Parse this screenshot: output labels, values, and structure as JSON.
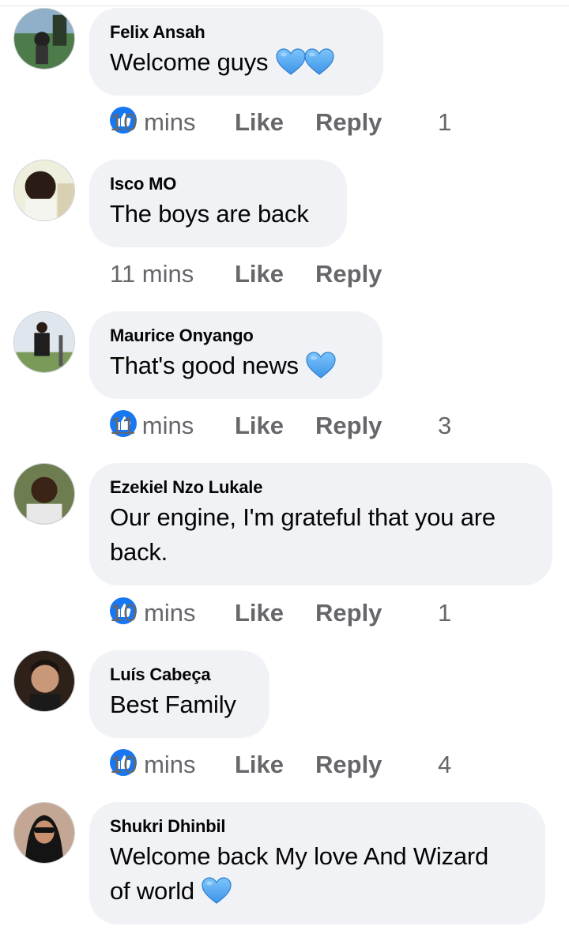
{
  "comments": [
    {
      "author": "Felix Ansah",
      "text": "Welcome guys",
      "hearts": 2,
      "time": "10 mins",
      "like": "Like",
      "reply": "Reply",
      "reactions": "1",
      "avatar_bg": "#3c6b3a"
    },
    {
      "author": "Isco MO",
      "text": "The boys are back",
      "hearts": 0,
      "time": "11 mins",
      "like": "Like",
      "reply": "Reply",
      "reactions": "",
      "avatar_bg": "#e8e8d8"
    },
    {
      "author": "Maurice Onyango",
      "text": "That's good news",
      "hearts": 1,
      "time": "11 mins",
      "like": "Like",
      "reply": "Reply",
      "reactions": "3",
      "avatar_bg": "#cfd8e0"
    },
    {
      "author": "Ezekiel Nzo Lukale",
      "text_line1": "Our engine, I'm grateful that you are",
      "text_line2": "back.",
      "hearts": 0,
      "time": "10 mins",
      "like": "Like",
      "reply": "Reply",
      "reactions": "1",
      "avatar_bg": "#6b7a4a"
    },
    {
      "author": "Luís Cabeça",
      "text": "Best Family",
      "hearts": 0,
      "time": "10 mins",
      "like": "Like",
      "reply": "Reply",
      "reactions": "4",
      "avatar_bg": "#3a2a22"
    },
    {
      "author": "Shukri Dhinbil",
      "text_line1": "Welcome back My love And Wizard",
      "text_line2": "of world",
      "hearts": 1,
      "time": "",
      "like": "",
      "reply": "",
      "reactions": "",
      "avatar_bg": "#b89a86"
    }
  ],
  "colors": {
    "heart": "#5aaef2",
    "like_badge": "#1877f2",
    "meta_text": "#65676b",
    "bubble": "#f0f2f5"
  },
  "icons": {
    "heart": "blue-heart-icon",
    "like_badge": "thumbs-up-icon"
  }
}
